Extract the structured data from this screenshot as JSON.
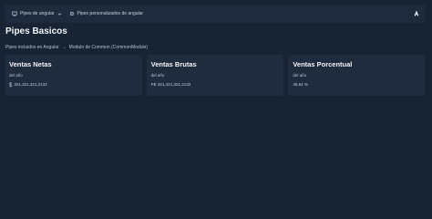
{
  "nav": {
    "items": [
      {
        "label": "Pipes de angular",
        "icon": "monitor-icon",
        "has_dropdown": true
      },
      {
        "label": "Pipes personalizados de angular",
        "icon": "gear-icon",
        "has_dropdown": false
      }
    ],
    "logo_icon": "angular-logo-icon"
  },
  "page": {
    "title": "Pipes Basicos",
    "breadcrumb": {
      "part1": "Pipes incluidos en Angular",
      "separator": "→",
      "part2": "Modulo de Common (CommonModule)"
    }
  },
  "cards": [
    {
      "title": "Ventas Netas",
      "subtitle": "del año",
      "currency_symbol": "$",
      "value": "321,321,321,2132"
    },
    {
      "title": "Ventas Brutas",
      "subtitle": "del año",
      "value": "PE 321,421,321,2132"
    },
    {
      "title": "Ventas Porcentual",
      "subtitle": "del año",
      "value": "45.54 %"
    }
  ],
  "colors": {
    "background": "#182333",
    "surface": "#1f2c3e",
    "topbar": "#1e2b3c",
    "text": "#f2f5f9"
  }
}
